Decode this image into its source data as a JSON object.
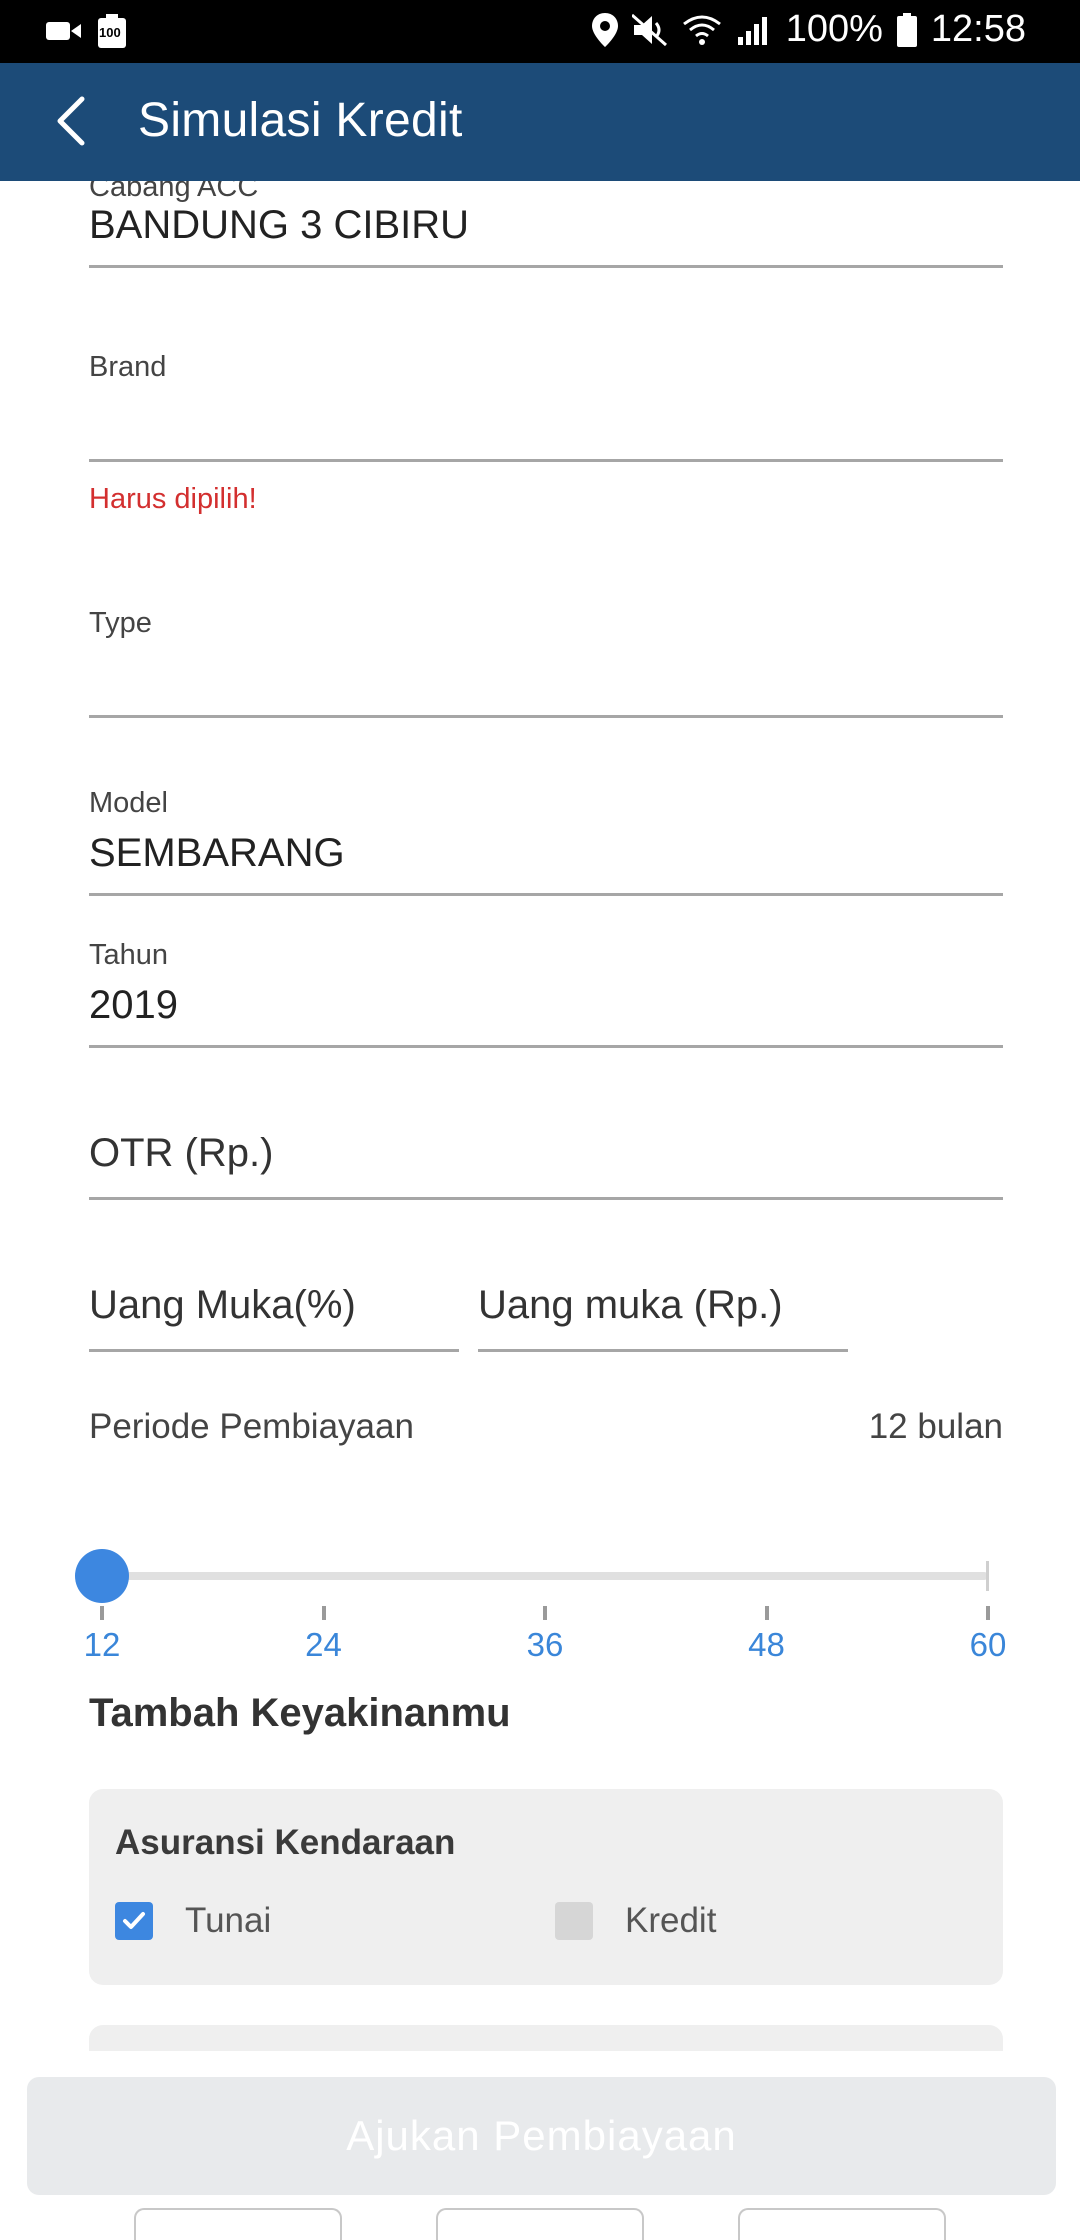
{
  "status_bar": {
    "battery_percent": "100%",
    "time": "12:58",
    "notification_badge": "100"
  },
  "app_bar": {
    "title": "Simulasi Kredit"
  },
  "form": {
    "cabang": {
      "label": "Cabang ACC",
      "value": "BANDUNG 3 CIBIRU"
    },
    "brand": {
      "label": "Brand",
      "value": "",
      "error": "Harus dipilih!"
    },
    "type": {
      "label": "Type",
      "value": ""
    },
    "model": {
      "label": "Model",
      "value": "SEMBARANG"
    },
    "tahun": {
      "label": "Tahun",
      "value": "2019"
    },
    "otr": {
      "placeholder": "OTR (Rp.)"
    },
    "uang_muka_pct": {
      "placeholder": "Uang Muka(%)"
    },
    "uang_muka_rp": {
      "placeholder": "Uang muka (Rp.)"
    }
  },
  "periode": {
    "label": "Periode Pembiayaan",
    "value_text": "12 bulan",
    "ticks": [
      "12",
      "24",
      "36",
      "48",
      "60"
    ],
    "selected_months": 12,
    "min": 12,
    "max": 60
  },
  "keyakinan": {
    "title": "Tambah Keyakinanmu",
    "asuransi_card": {
      "title": "Asuransi Kendaraan",
      "options": [
        {
          "label": "Tunai",
          "checked": true
        },
        {
          "label": "Kredit",
          "checked": false
        }
      ]
    }
  },
  "submit_button": {
    "label": "Ajukan Pembiayaan"
  },
  "colors": {
    "app_bar": "#1c4b78",
    "accent": "#3d87e0",
    "error": "#d32f2f",
    "button_disabled_bg": "#e8eaec"
  }
}
